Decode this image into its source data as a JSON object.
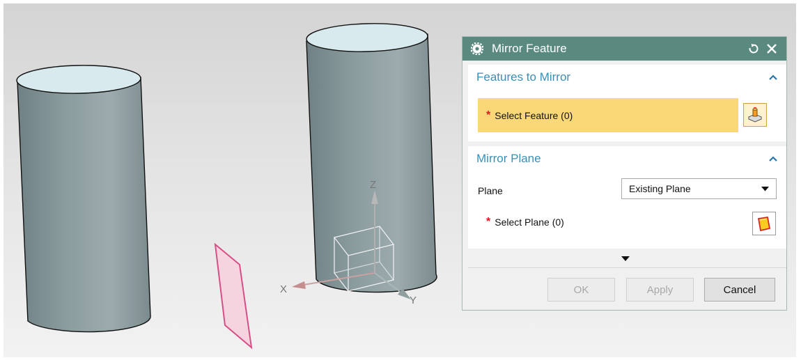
{
  "dialog": {
    "title": "Mirror Feature",
    "reset_icon": "reset-icon",
    "close_icon": "close-icon",
    "features_group": {
      "title": "Features to Mirror",
      "select_label": "Select Feature (0)",
      "required_mark": "*",
      "icon": "select-feature-icon"
    },
    "plane_group": {
      "title": "Mirror Plane",
      "plane_label": "Plane",
      "plane_value": "Existing Plane",
      "select_label": "Select Plane (0)",
      "required_mark": "*",
      "icon": "select-plane-icon"
    },
    "buttons": {
      "ok": "OK",
      "apply": "Apply",
      "cancel": "Cancel"
    }
  },
  "viewport": {
    "axis_labels": {
      "x": "X",
      "y": "Y",
      "z": "Z"
    }
  },
  "colors": {
    "title_bar": "#5a8a7f",
    "group_title": "#3a8fb7",
    "selection_highlight": "#fad878",
    "required_star": "#e0181d",
    "cylinder_body": "#86979a",
    "cylinder_top": "#d8eaee",
    "mirror_plane": "#f6d4df"
  }
}
